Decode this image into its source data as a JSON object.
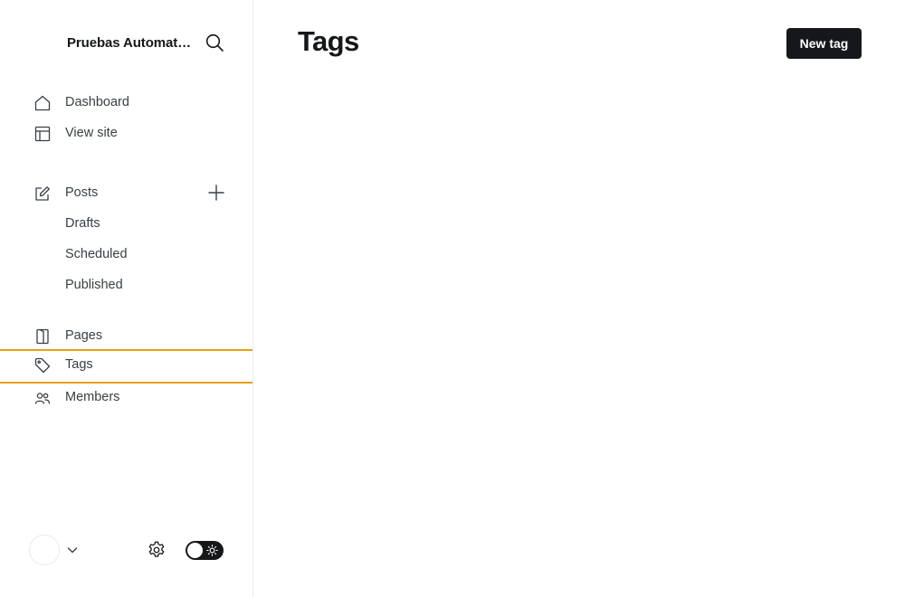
{
  "sidebar": {
    "site_title": "Pruebas Automatizadas",
    "nav_primary": [
      {
        "label": "Dashboard",
        "icon": "home-icon"
      },
      {
        "label": "View site",
        "icon": "layout-icon"
      }
    ],
    "posts": {
      "label": "Posts",
      "icon": "pencil-icon",
      "subitems": [
        {
          "label": "Drafts"
        },
        {
          "label": "Scheduled"
        },
        {
          "label": "Published"
        }
      ]
    },
    "nav_secondary": [
      {
        "label": "Pages",
        "icon": "page-icon"
      },
      {
        "label": "Tags",
        "icon": "tag-icon",
        "active": true
      },
      {
        "label": "Members",
        "icon": "members-icon"
      }
    ]
  },
  "main": {
    "title": "Tags",
    "new_button_label": "New tag"
  },
  "colors": {
    "accent_outline": "#e6a118",
    "primary_dark": "#15171a",
    "text_muted": "#394047"
  }
}
